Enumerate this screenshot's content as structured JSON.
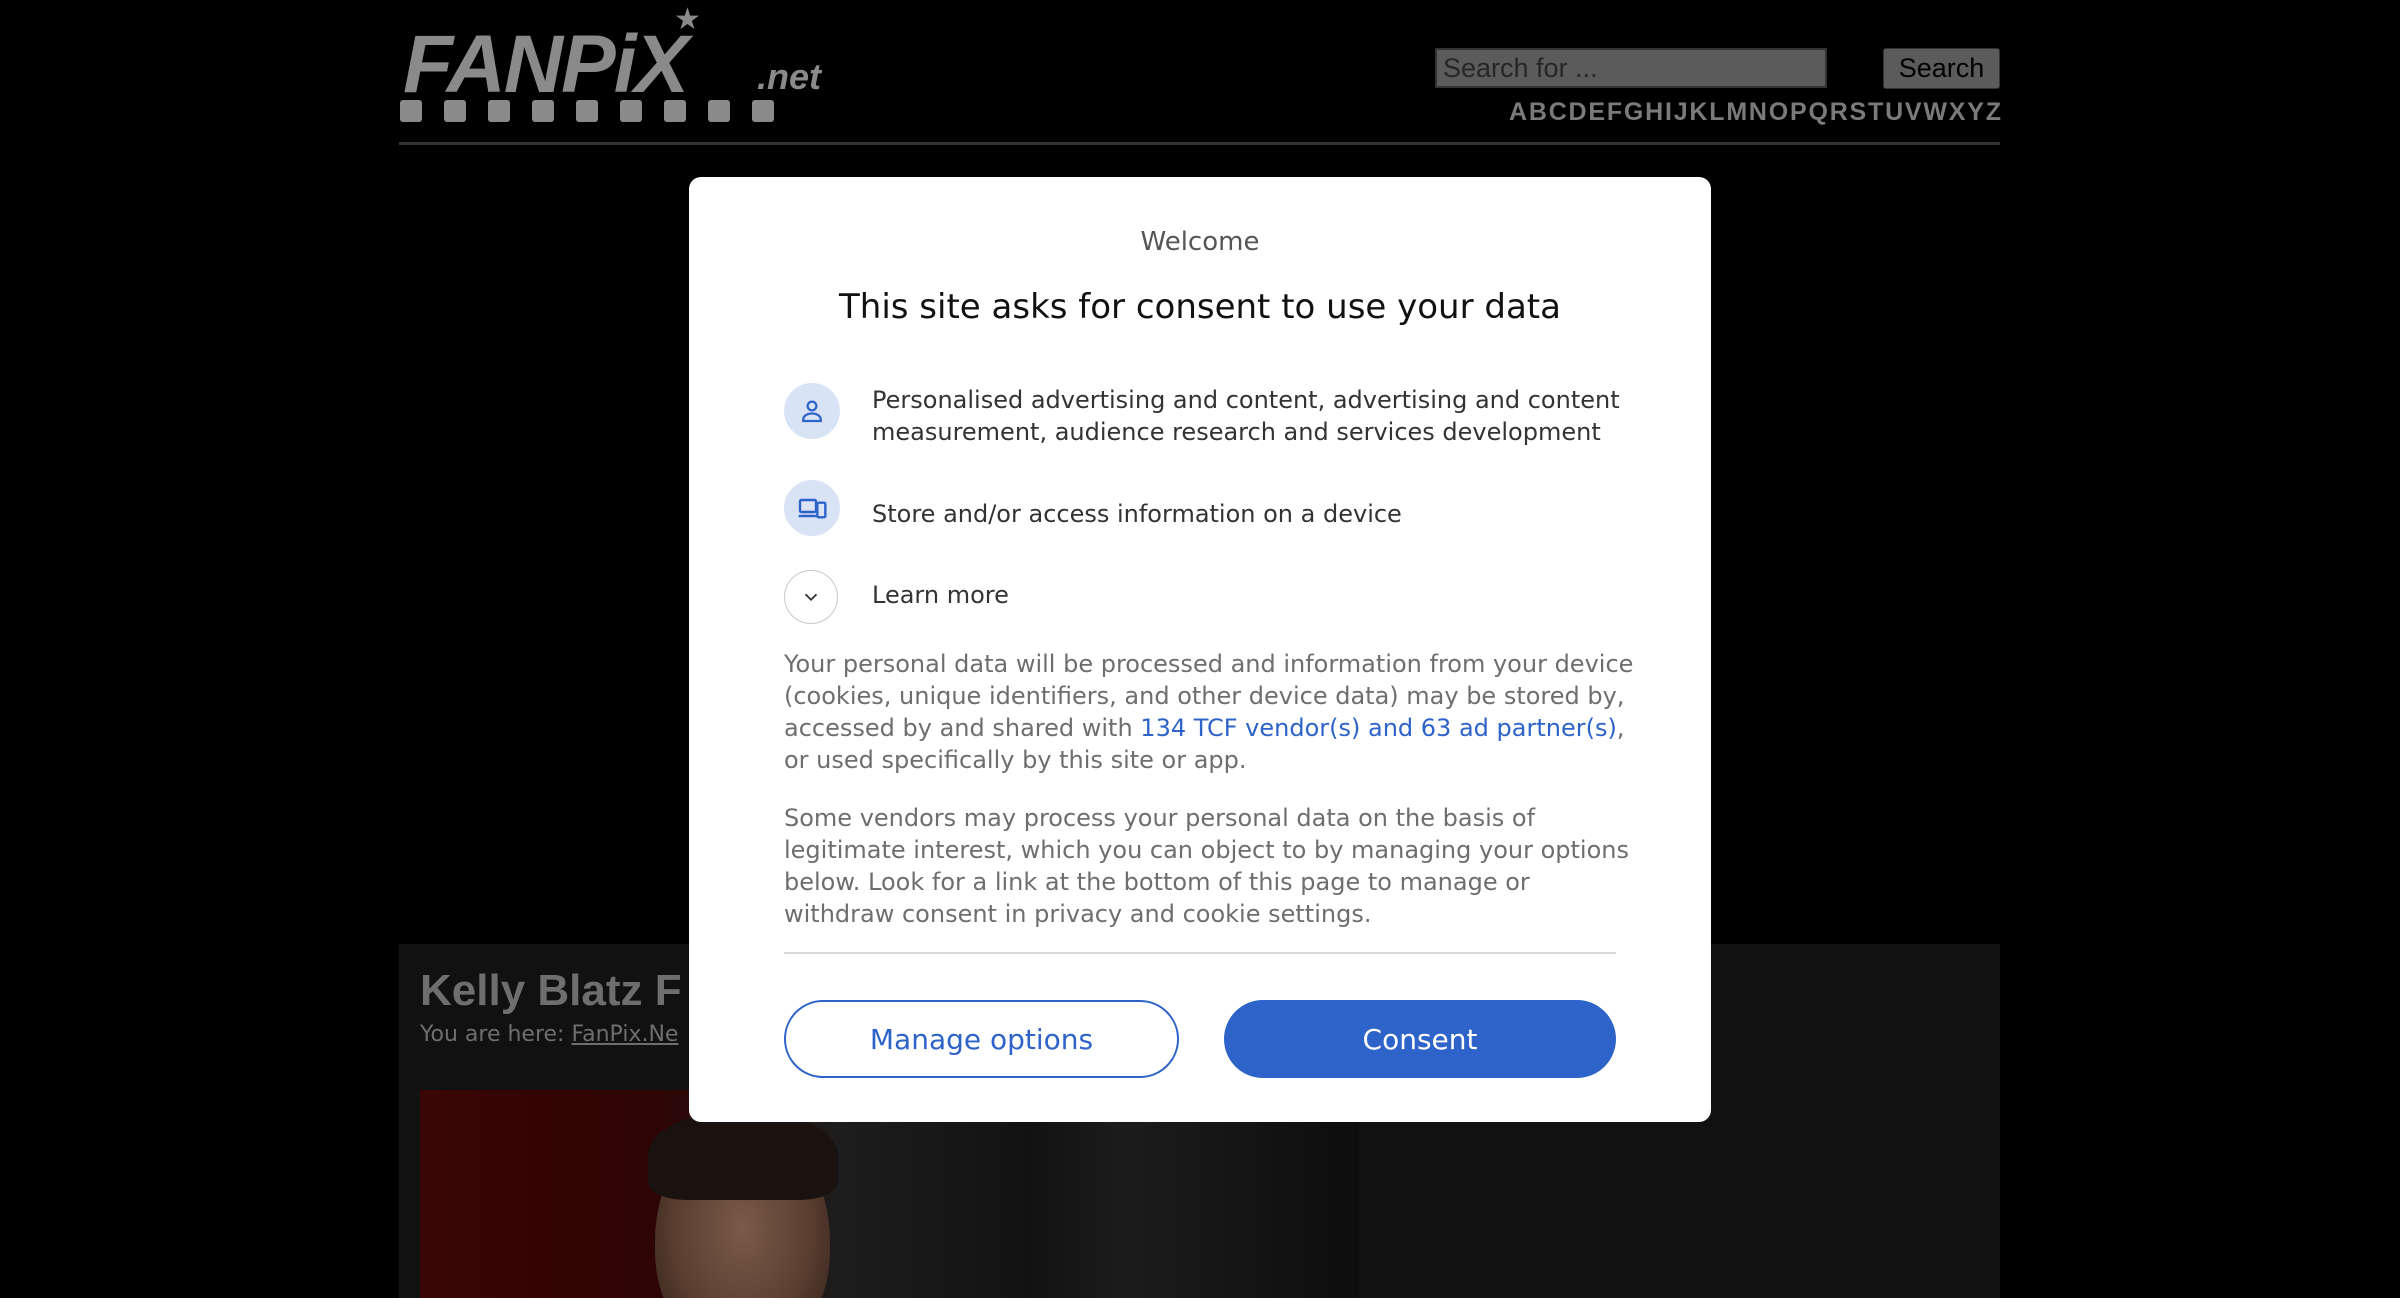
{
  "header": {
    "logo": {
      "name": "FANPiX",
      "tld": ".net"
    },
    "search": {
      "placeholder": "Search for ...",
      "button_label": "Search"
    },
    "alphabet": [
      "A",
      "B",
      "C",
      "D",
      "E",
      "F",
      "G",
      "H",
      "I",
      "J",
      "K",
      "L",
      "M",
      "N",
      "O",
      "P",
      "Q",
      "R",
      "S",
      "T",
      "U",
      "V",
      "W",
      "X",
      "Y",
      "Z"
    ]
  },
  "content": {
    "page_title": "Kelly Blatz F",
    "breadcrumb_prefix": "You are here:",
    "breadcrumb_link": "FanPix.Ne"
  },
  "consent": {
    "welcome": "Welcome",
    "title": "This site asks for consent to use your data",
    "purposes": [
      {
        "icon": "person-icon",
        "text": "Personalised advertising and content, advertising and content measurement, audience research and services development"
      },
      {
        "icon": "devices-icon",
        "text": "Store and/or access information on a device"
      }
    ],
    "learn_more": "Learn more",
    "paragraph1": {
      "before": "Your personal data will be processed and information from your device (cookies, unique identifiers, and other device data) may be stored by, accessed by and shared with ",
      "link": "134 TCF vendor(s) and 63 ad partner(s)",
      "after": ", or used specifically by this site or app."
    },
    "paragraph2": "Some vendors may process your personal data on the basis of legitimate interest, which you can object to by managing your options below. Look for a link at the bottom of this page to manage or withdraw consent in privacy and cookie settings.",
    "manage_button": "Manage options",
    "consent_button": "Consent",
    "colors": {
      "accent": "#2e63c9",
      "icon_background": "#d8e3f6"
    }
  }
}
